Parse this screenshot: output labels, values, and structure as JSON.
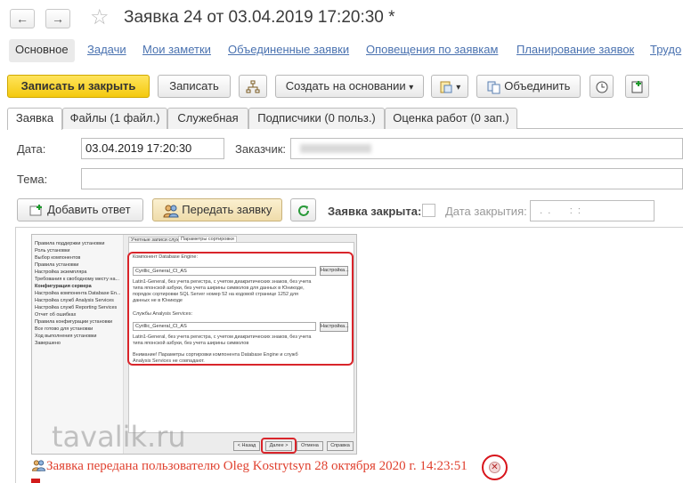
{
  "window": {
    "title": "Заявка 24 от 03.04.2019 17:20:30 *",
    "back_glyph": "←",
    "forward_glyph": "→",
    "star_glyph": "☆"
  },
  "nav": {
    "items": [
      "Основное",
      "Задачи",
      "Мои заметки",
      "Объединенные заявки",
      "Оповещения по заявкам",
      "Планирование заявок",
      "Трудо"
    ]
  },
  "toolbar": {
    "save_close": "Записать и закрыть",
    "save": "Записать",
    "create_based": "Создать на основании",
    "merge": "Объединить",
    "dropdown_glyph": "▾"
  },
  "tabs": [
    "Заявка",
    "Файлы (1 файл.)",
    "Служебная",
    "Подписчики (0 польз.)",
    "Оценка работ (0 зап.)"
  ],
  "form": {
    "date_label": "Дата:",
    "date_value": "03.04.2019 17:20:30",
    "customer_label": "Заказчик:",
    "topic_label": "Тема:",
    "add_reply": "Добавить ответ",
    "transfer": "Передать заявку",
    "closed_label": "Заявка закрыта:",
    "close_date_label": "Дата закрытия:",
    "close_date_value": "  .  .       :  :  "
  },
  "embedded": {
    "side_items": [
      "Правила поддержки установки",
      "Роль установки",
      "Выбор компонентов",
      "Правила установки",
      "Настройка экземпляра",
      "Требования к свободному месту на...",
      "Конфигурация сервера",
      "Настройка компонента Database En...",
      "Настройка служб Analysis Services",
      "Настройка служб Reporting Services",
      "Отчет об ошибках",
      "Правила конфигурации установки",
      "Все готово для установки",
      "Ход выполнения установки",
      "Завершено"
    ],
    "tab1": "Учетные записи служб",
    "tab2": "Параметры сортировки",
    "engine_label": "Компонент Database Engine:",
    "engine_value": "Cyrillic_General_CI_AS",
    "engine_desc": "Latin1-General, без учета регистра, с учетом диакритических знаков, без учета типа японской азбуки, без учета ширины символов для данных в Юникоде, порядок сортировки SQL Server номер 52 на кодовой странице 1252 для данных не в Юникоде",
    "as_label": "Службы Analysis Services:",
    "as_value": "Cyrillic_General_CI_AS",
    "as_desc": "Latin1-General, без учета регистра, с учетом диакритических знаков, без учета типа японской азбуки, без учета ширины символов",
    "warning": "Внимание! Параметры сортировки компонента Database Engine и служб Analysis Services не совпадают.",
    "configure": "Настройка...",
    "btn_back": "< Назад",
    "btn_next": "Далее >",
    "btn_cancel": "Отмена",
    "btn_help": "Справка",
    "watermark": "tavalik.ru"
  },
  "message": "Заявка передана пользователю Oleg Kostrytsyn 28 октября 2020 г. 14:23:51",
  "close_glyph": "✕",
  "colors": {
    "accent_yellow": "#f4c90e",
    "link_blue": "#4a72b0",
    "message_red": "#e0412f",
    "highlight_red": "#d9252b"
  }
}
